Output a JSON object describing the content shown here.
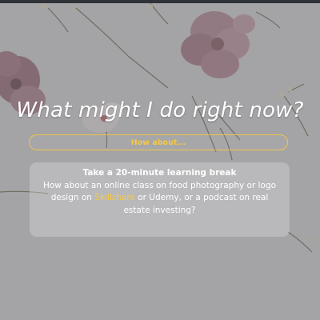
{
  "question": "What might I do right now?",
  "button": {
    "label": "How about..."
  },
  "suggestion": {
    "title": "Take a 20-minute learning break",
    "text_before": "How about an online class on food photography or logo design on ",
    "link_label": "Skillshare",
    "text_after": " or Udemy, or a podcast on real estate investing?"
  },
  "colors": {
    "accent": "#f2c94c",
    "text": "#ffffff",
    "top_strip": "#2f3236"
  }
}
